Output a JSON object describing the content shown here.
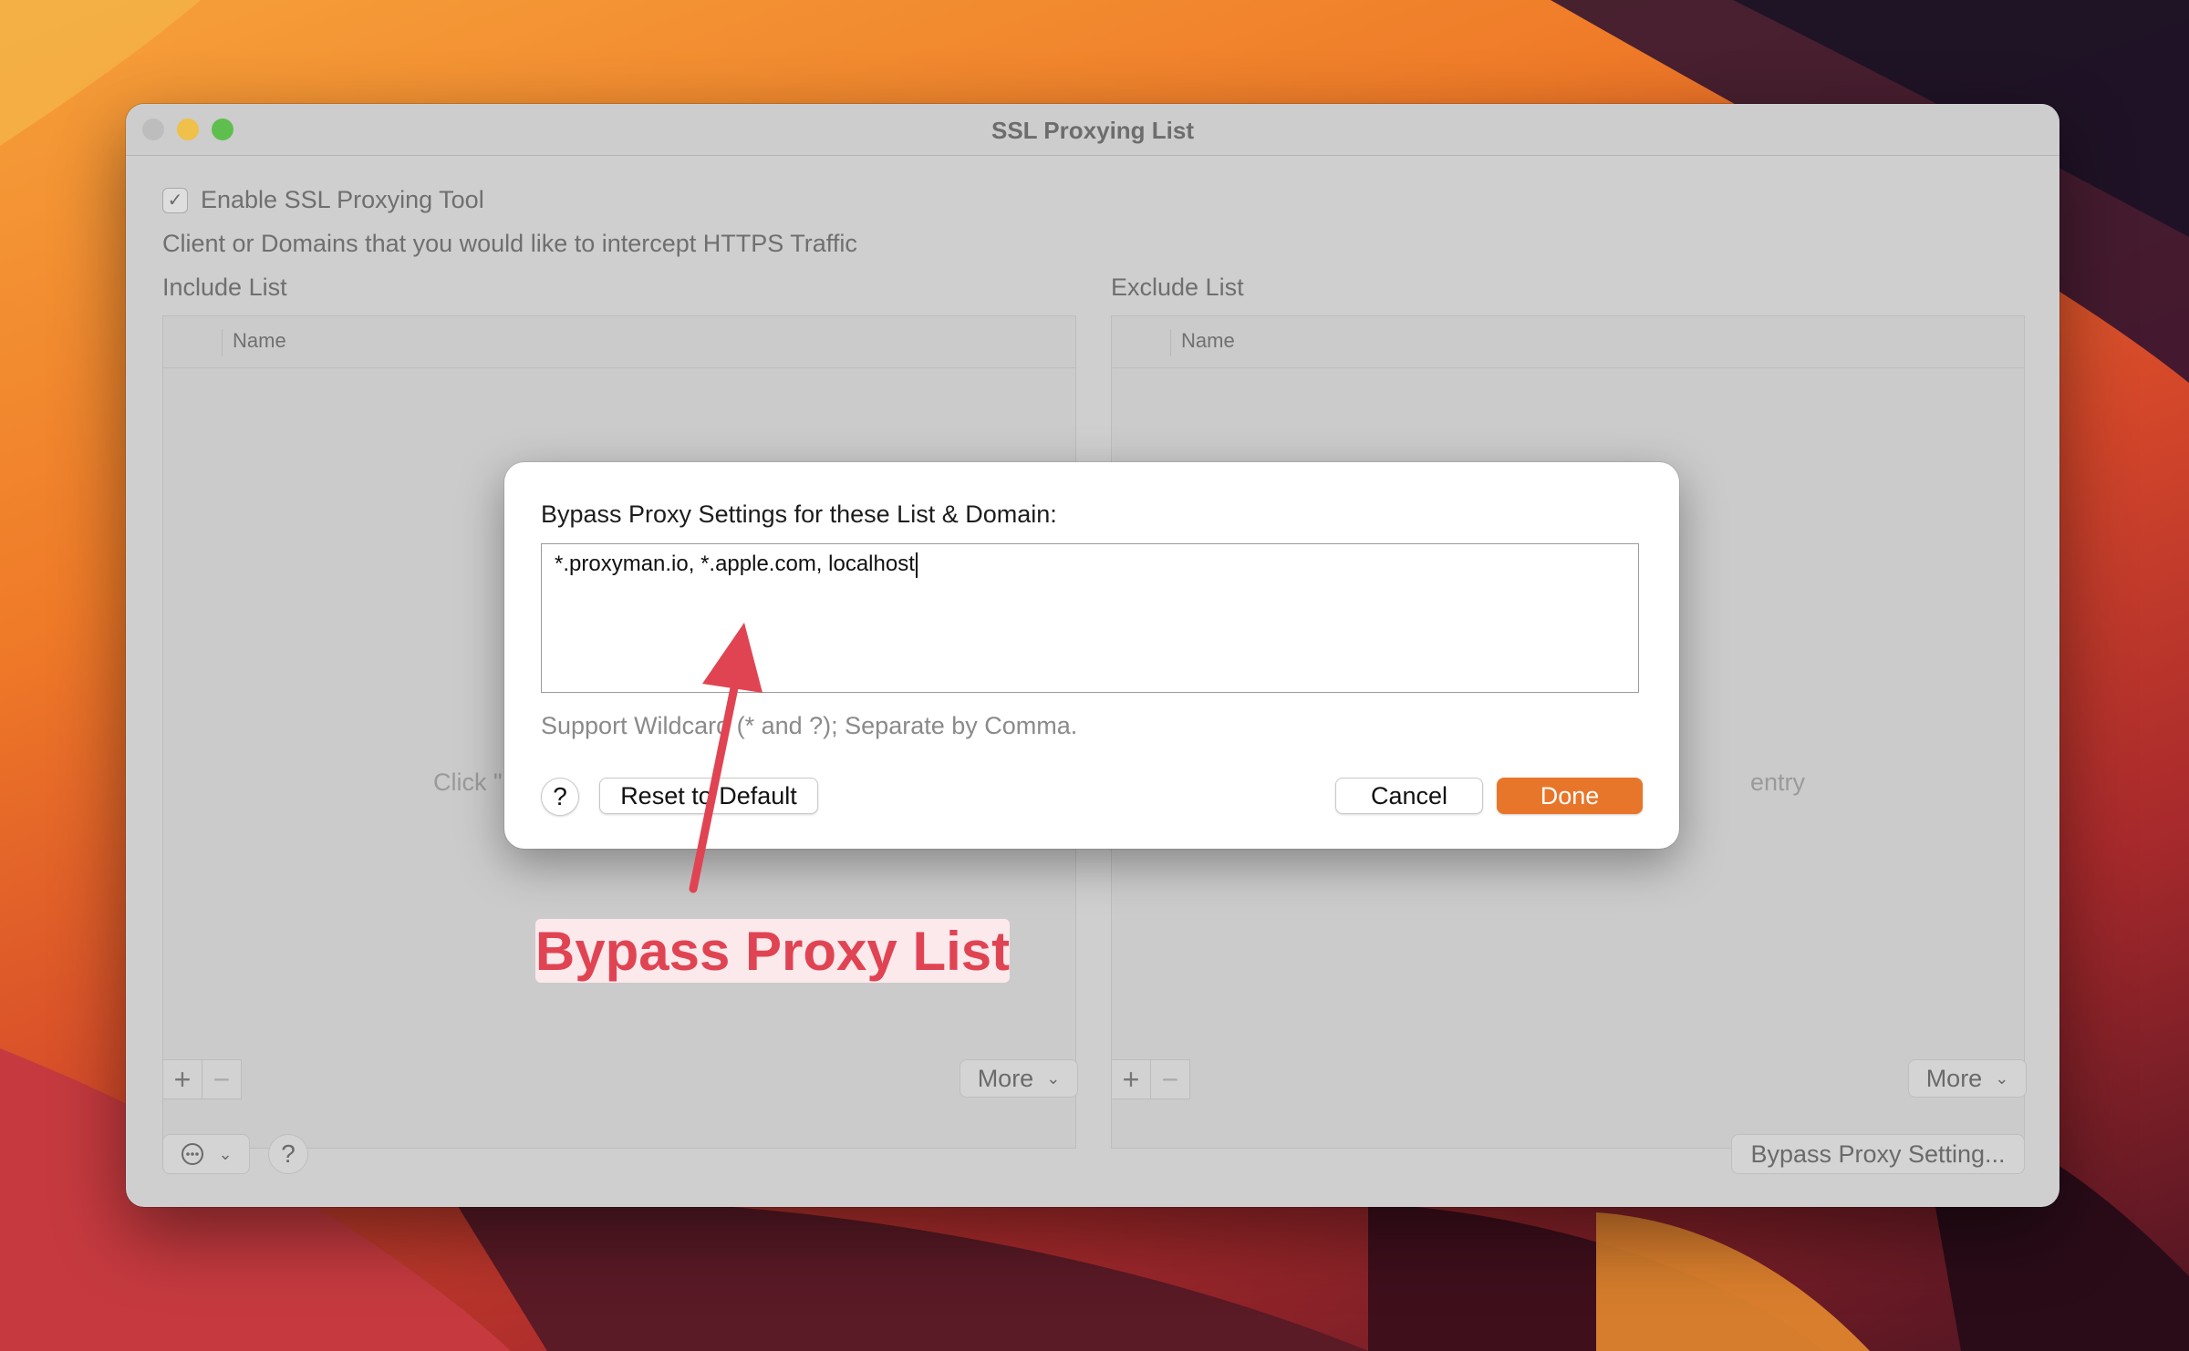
{
  "window": {
    "title": "SSL Proxying List"
  },
  "settings": {
    "enable_label": "Enable SSL Proxying Tool",
    "enable_checked": true,
    "description": "Client or Domains that you would like to intercept HTTPS Traffic"
  },
  "include_list": {
    "label": "Include List",
    "column_name": "Name",
    "empty_hint_visible": "Click \"",
    "more_label": "More"
  },
  "exclude_list": {
    "label": "Exclude List",
    "column_name": "Name",
    "empty_hint_visible": "entry",
    "more_label": "More"
  },
  "footer": {
    "bypass_button_label": "Bypass Proxy Setting...",
    "help_label": "?"
  },
  "dialog": {
    "title": "Bypass Proxy Settings for these List & Domain:",
    "textarea_value": "*.proxyman.io, *.apple.com, localhost",
    "hint": "Support Wildcard (* and ?); Separate by Comma.",
    "help_label": "?",
    "reset_label": "Reset to Default",
    "cancel_label": "Cancel",
    "done_label": "Done",
    "accent_color": "#e8762a"
  },
  "annotation": {
    "callout_text": "Bypass Proxy List",
    "color": "#e04453"
  },
  "icons": {
    "add": "+",
    "remove": "−",
    "chevron": "⌄",
    "more_actions": "ellipsis-circle"
  }
}
